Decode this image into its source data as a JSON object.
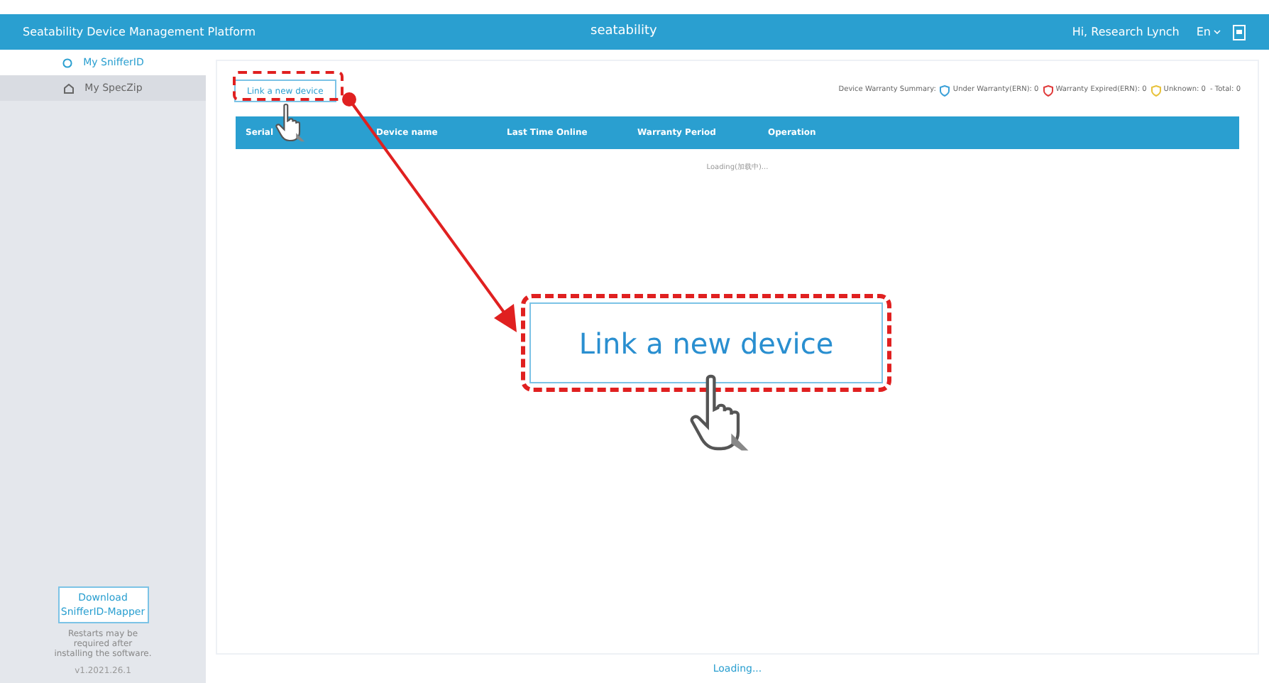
{
  "header": {
    "title": "Seatability Device Management Platform",
    "center": "seatability",
    "user": "Hi, Research Lynch",
    "language": "En"
  },
  "sidebar": {
    "items": [
      {
        "label": "My SnifferID",
        "selected": true
      },
      {
        "label": "My SpecZip",
        "selected": false
      }
    ],
    "download_button": "Download SnifferID-Mapper",
    "note": "Restarts may be required after installing the software.",
    "version": "v1.2021.26.1"
  },
  "toolbar": {
    "link_button": "Link a new device",
    "summary_label": "Device Warranty Summary:",
    "summary": [
      {
        "label": "Under Warranty(ERN): 0",
        "color": "#3aa0d8"
      },
      {
        "label": "Warranty Expired(ERN): 0",
        "color": "#e03a3a"
      },
      {
        "label": "Unknown: 0",
        "color": "#e8c23a"
      }
    ],
    "total": "- Total: 0"
  },
  "table": {
    "columns": [
      "Serial",
      "Device name",
      "Last Time Online",
      "Warranty Period",
      "Operation"
    ],
    "loading": "Loading(加载中)..."
  },
  "footer": "Loading...",
  "callout": {
    "text": "Link a new device"
  }
}
